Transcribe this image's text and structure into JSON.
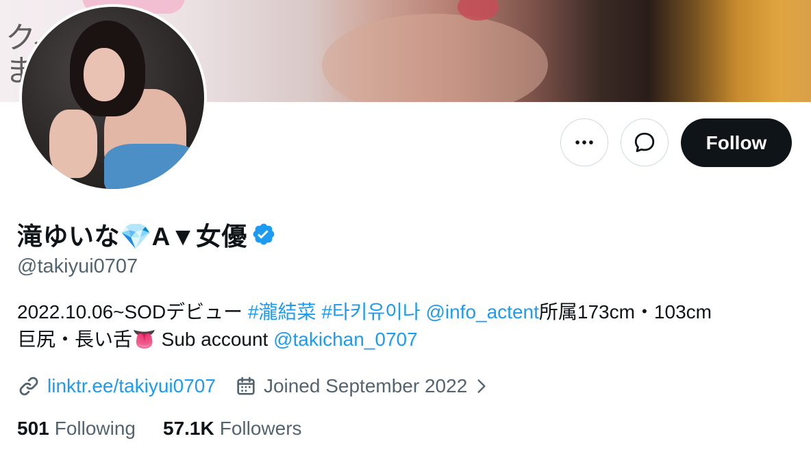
{
  "profile": {
    "display_name": "滝ゆいな💎A▼女優",
    "handle": "@takiyui0707",
    "verified": true
  },
  "banner": {
    "glyph_line1": "ク、",
    "glyph_line2": "ま"
  },
  "actions": {
    "follow_label": "Follow"
  },
  "bio": {
    "part1": "2022.10.06~SODデビュー ",
    "hashtag1": "#瀧結菜",
    "space1": " ",
    "hashtag2": "#타키유이나",
    "space2": " ",
    "mention1": "@info_actent",
    "part2": "所属173cm・103cm",
    "part3": "巨尻・長い舌👅 Sub account ",
    "mention2": "@takichan_0707"
  },
  "meta": {
    "link_text": "linktr.ee/takiyui0707",
    "joined_text": "Joined September 2022"
  },
  "counts": {
    "following_num": "501",
    "following_label": "Following",
    "followers_num": "57.1K",
    "followers_label": "Followers"
  },
  "icons": {
    "more": "more-horizontal-icon",
    "message": "message-icon",
    "verified": "verified-badge-icon",
    "link": "link-icon",
    "calendar": "calendar-icon",
    "chevron": "chevron-right-icon"
  },
  "colors": {
    "accent": "#1d9bf0",
    "text": "#0f1419",
    "secondary": "#536471",
    "follow_bg": "#0f1419",
    "border": "#cfd9de"
  }
}
